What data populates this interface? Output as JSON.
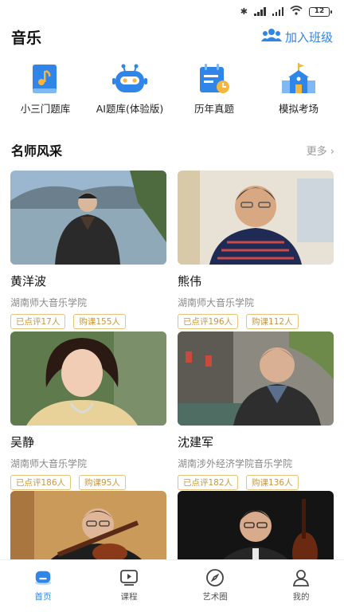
{
  "status": {
    "battery": "12"
  },
  "header": {
    "title": "音乐",
    "join_label": "加入班级"
  },
  "quick_entries": [
    {
      "label": "小三门题库",
      "icon": "music-book-icon"
    },
    {
      "label": "AI题库(体验版)",
      "icon": "robot-icon"
    },
    {
      "label": "历年真题",
      "icon": "calendar-clock-icon"
    },
    {
      "label": "模拟考场",
      "icon": "school-building-icon"
    }
  ],
  "section": {
    "title": "名师风采",
    "more": "更多 ›"
  },
  "teachers": [
    {
      "name": "黄洋波",
      "school": "湖南师大音乐学院",
      "rated": "已点评17人",
      "bought": "购课155人"
    },
    {
      "name": "熊伟",
      "school": "湖南师大音乐学院",
      "rated": "已点评196人",
      "bought": "购课112人"
    },
    {
      "name": "吴静",
      "school": "湖南师大音乐学院",
      "rated": "已点评186人",
      "bought": "购课95人"
    },
    {
      "name": "沈建军",
      "school": "湖南涉外经济学院音乐学院",
      "rated": "已点评182人",
      "bought": "购课136人"
    },
    {
      "name": "",
      "school": "",
      "rated": "",
      "bought": ""
    },
    {
      "name": "",
      "school": "",
      "rated": "",
      "bought": ""
    }
  ],
  "tabs": [
    {
      "label": "首页",
      "icon": "home-icon",
      "active": true
    },
    {
      "label": "课程",
      "icon": "video-play-icon",
      "active": false
    },
    {
      "label": "艺术圈",
      "icon": "compass-icon",
      "active": false
    },
    {
      "label": "我的",
      "icon": "user-icon",
      "active": false
    }
  ],
  "colors": {
    "accent": "#2f86e8",
    "tag_border": "#e6c27a",
    "tag_text": "#c9963a"
  }
}
